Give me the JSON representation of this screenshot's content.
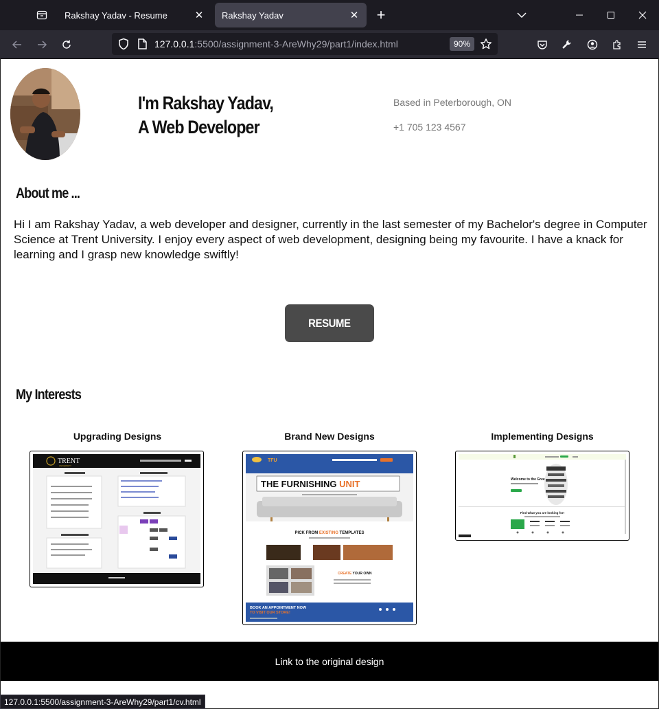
{
  "browser": {
    "tabs": [
      {
        "title": "Rakshay Yadav - Resume",
        "active": false
      },
      {
        "title": "Rakshay Yadav",
        "active": true
      }
    ],
    "url_host": "127.0.0.1",
    "url_rest": ":5500/assignment-3-AreWhy29/part1/index.html",
    "zoom": "90%",
    "status_url": "127.0.0.1:5500/assignment-3-AreWhy29/part1/cv.html"
  },
  "hero": {
    "line1": "I'm Rakshay Yadav,",
    "line2": "A Web Developer",
    "location": "Based in Peterborough, ON",
    "phone": "+1 705 123 4567"
  },
  "about": {
    "heading": "About me ...",
    "text": "Hi I am Rakshay Yadav, a web developer and designer, currently in the last semester of my Bachelor's degree in Computer Science at Trent University. I enjoy every aspect of web development, designing being my favourite. I have a knack for learning and I grasp new knowledge swiftly!"
  },
  "resume_button": "RESUME",
  "interests": {
    "heading": "My Interests",
    "items": [
      {
        "title": "Upgrading Designs"
      },
      {
        "title": "Brand New Designs"
      },
      {
        "title": "Implementing Designs"
      }
    ]
  },
  "thumb_text": {
    "trent": "TRENT",
    "trent_sub": "UNIVERSITY",
    "tfu_logo": "TFU",
    "tfu_headline_1": "THE FURNISHING ",
    "tfu_headline_2": "UNIT",
    "tfu_pick_1": "PICK FROM ",
    "tfu_pick_2": "EXISTING",
    "tfu_pick_3": " TEMPLATES",
    "tfu_create_1": "CREATE",
    "tfu_create_2": " YOUR OWN",
    "tfu_book_1": "BOOK AN APPOINTMENT NOW",
    "tfu_book_2": "TO VISIT OUR STORE!",
    "green_welcome": "Welcome to the Green Side",
    "green_find": "Find what you are looking for!"
  },
  "footer": {
    "link": "Link to the original design"
  },
  "colors": {
    "accent_orange": "#e8722a",
    "tfu_blue": "#2b57a6",
    "resume_bg": "#4a4a4a"
  }
}
